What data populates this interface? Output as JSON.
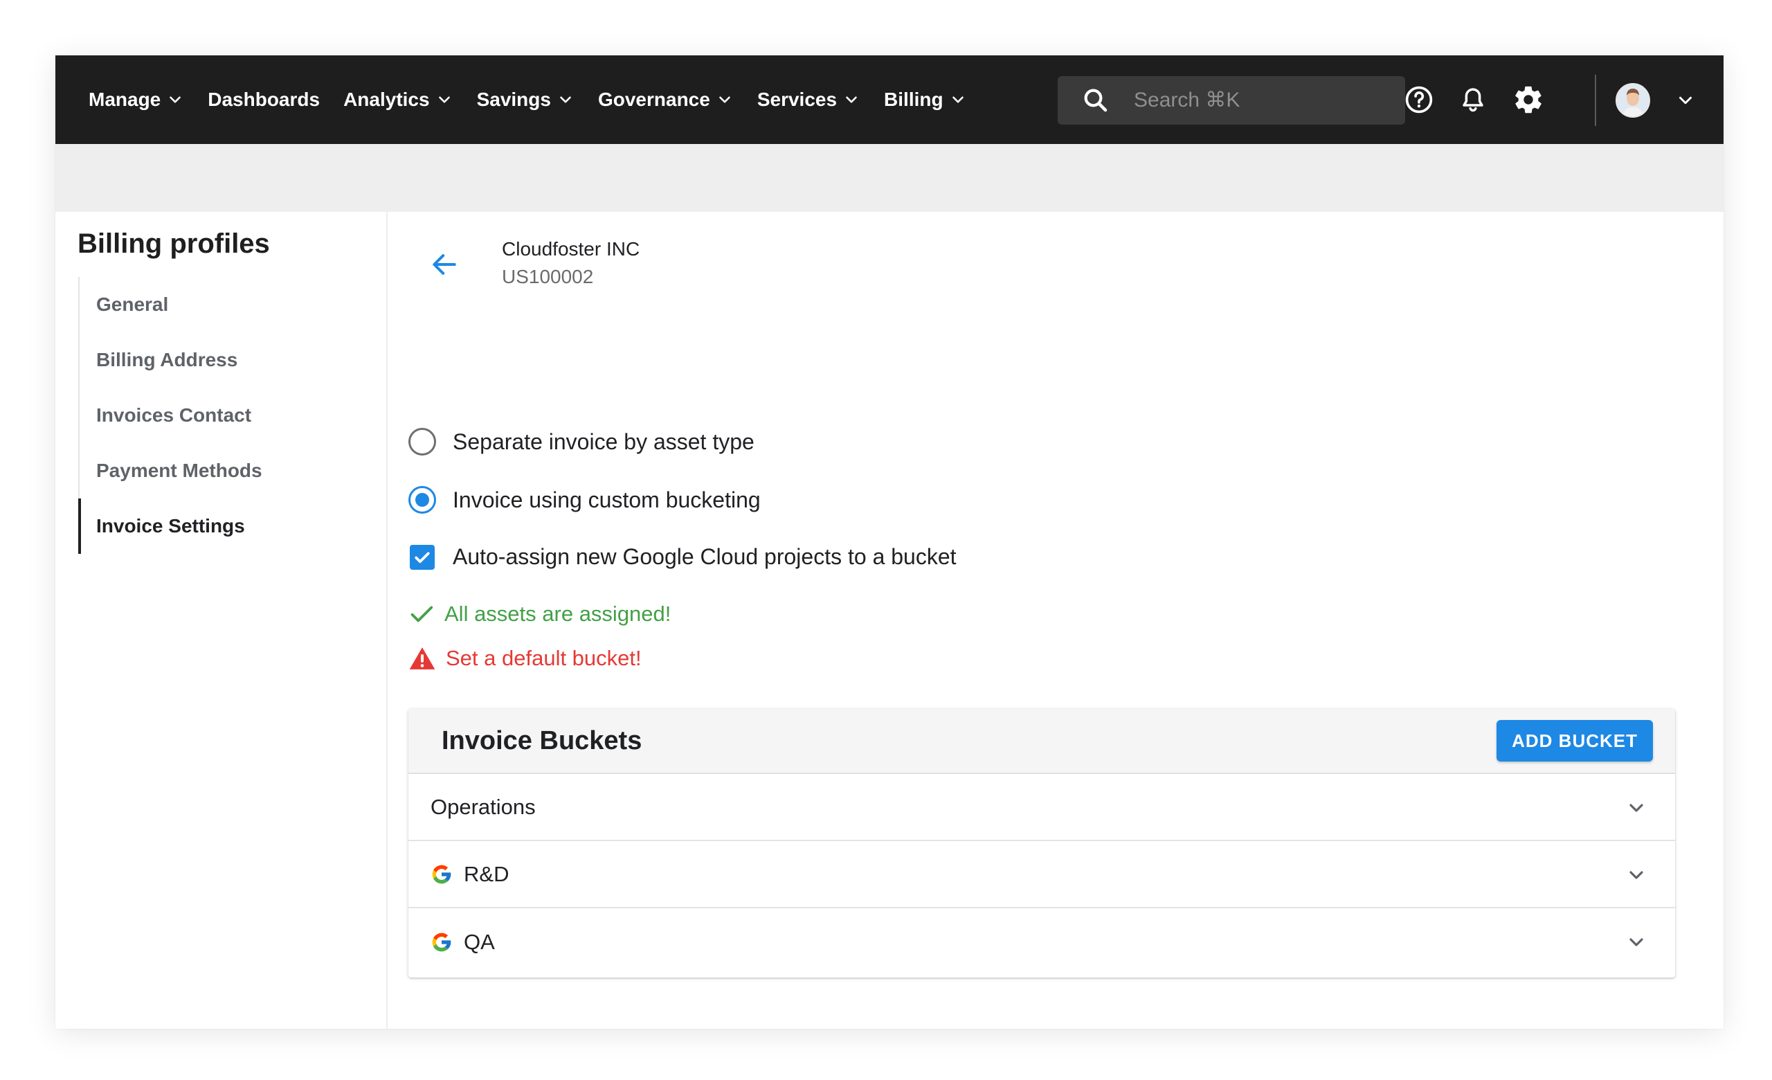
{
  "nav": {
    "items": [
      {
        "label": "Manage",
        "has_menu": true
      },
      {
        "label": "Dashboards",
        "has_menu": false
      },
      {
        "label": "Analytics",
        "has_menu": true
      },
      {
        "label": "Savings",
        "has_menu": true
      },
      {
        "label": "Governance",
        "has_menu": true
      },
      {
        "label": "Services",
        "has_menu": true
      },
      {
        "label": "Billing",
        "has_menu": true
      }
    ],
    "search_placeholder": "Search ⌘K",
    "icons": [
      "help-circle-icon",
      "bell-icon",
      "gear-icon"
    ]
  },
  "sidebar": {
    "title": "Billing profiles",
    "items": [
      {
        "label": "General"
      },
      {
        "label": "Billing Address"
      },
      {
        "label": "Invoices Contact"
      },
      {
        "label": "Payment Methods"
      },
      {
        "label": "Invoice Settings",
        "active": true
      }
    ]
  },
  "header": {
    "org_name": "Cloudfoster INC",
    "org_id": "US100002"
  },
  "options": {
    "separate_invoice": "Separate invoice by asset type",
    "custom_bucketing": "Invoice using custom bucketing",
    "auto_assign": "Auto-assign new Google Cloud projects to a bucket",
    "selected": "custom_bucketing",
    "auto_assign_checked": true
  },
  "status": {
    "success": "All assets are assigned!",
    "warning": "Set a default bucket!"
  },
  "buckets": {
    "title": "Invoice Buckets",
    "add_label": "ADD BUCKET",
    "items": [
      {
        "label": "Operations",
        "google": false
      },
      {
        "label": "R&D",
        "google": true
      },
      {
        "label": "QA",
        "google": true
      }
    ]
  },
  "colors": {
    "nav_bg": "#1e1e1e",
    "accent": "#1e88e5",
    "success": "#43a047",
    "error": "#e53935"
  }
}
